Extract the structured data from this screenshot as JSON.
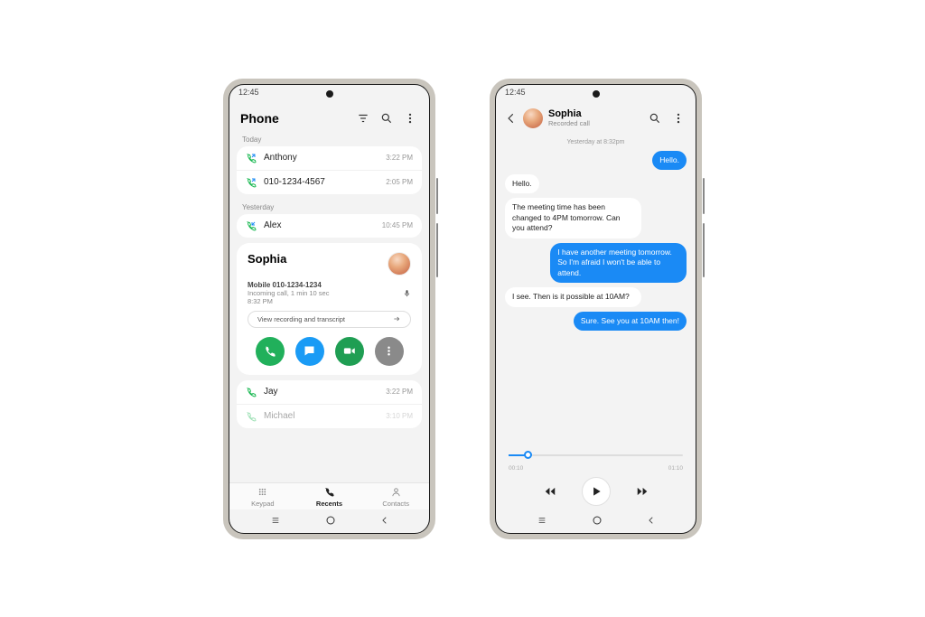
{
  "status_time": "12:45",
  "phone1": {
    "title": "Phone",
    "sections": [
      {
        "label": "Today",
        "items": [
          {
            "name": "Anthony",
            "time": "3:22 PM",
            "type": "out"
          },
          {
            "name": "010-1234-4567",
            "time": "2:05 PM",
            "type": "out"
          }
        ]
      },
      {
        "label": "Yesterday",
        "items": [
          {
            "name": "Alex",
            "time": "10:45 PM",
            "type": "in"
          }
        ]
      }
    ],
    "expanded": {
      "name": "Sophia",
      "phone": "Mobile 010-1234-1234",
      "detail": "Incoming call, 1 min 10 sec",
      "time": "8:32 PM",
      "view_label": "View recording and transcript"
    },
    "more": [
      {
        "name": "Jay",
        "time": "3:22 PM"
      },
      {
        "name": "Michael",
        "time": "3:10 PM"
      }
    ],
    "nav": {
      "keypad": "Keypad",
      "recents": "Recents",
      "contacts": "Contacts"
    }
  },
  "phone2": {
    "name": "Sophia",
    "subtitle": "Recorded call",
    "timestamp": "Yesterday at 8:32pm",
    "messages": [
      {
        "side": "out",
        "text": "Hello."
      },
      {
        "side": "in",
        "text": "Hello."
      },
      {
        "side": "in",
        "text": "The meeting time has been changed to 4PM tomorrow. Can you attend?"
      },
      {
        "side": "out",
        "text": "I have another meeting tomorrow. So I'm afraid I won't be able to attend."
      },
      {
        "side": "in",
        "text": "I see. Then is it possible at 10AM?"
      },
      {
        "side": "out",
        "text": "Sure. See you at 10AM then!"
      }
    ],
    "player": {
      "current": "00:10",
      "total": "01:10"
    }
  }
}
